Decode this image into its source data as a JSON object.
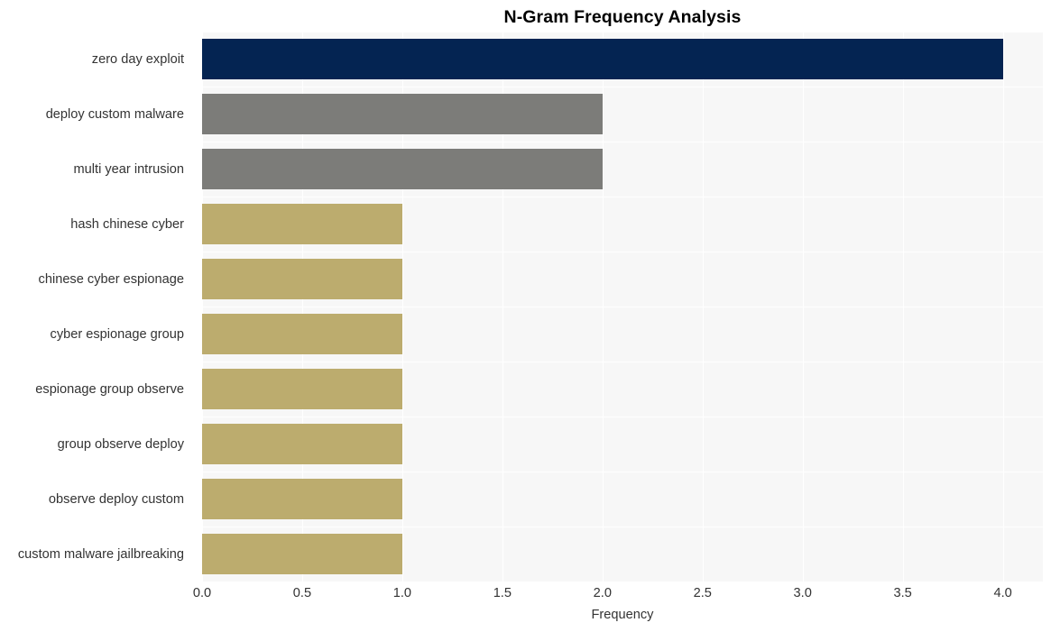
{
  "chart_data": {
    "type": "bar",
    "orientation": "horizontal",
    "title": "N-Gram Frequency Analysis",
    "xlabel": "Frequency",
    "ylabel": "",
    "categories": [
      "zero day exploit",
      "deploy custom malware",
      "multi year intrusion",
      "hash chinese cyber",
      "chinese cyber espionage",
      "cyber espionage group",
      "espionage group observe",
      "group observe deploy",
      "observe deploy custom",
      "custom malware jailbreaking"
    ],
    "values": [
      4,
      2,
      2,
      1,
      1,
      1,
      1,
      1,
      1,
      1
    ],
    "bar_colors": [
      "#042452",
      "#7c7c79",
      "#7c7c79",
      "#bcac6e",
      "#bcac6e",
      "#bcac6e",
      "#bcac6e",
      "#bcac6e",
      "#bcac6e",
      "#bcac6e"
    ],
    "xlim": [
      0.0,
      4.2
    ],
    "xticks": [
      0.0,
      0.5,
      1.0,
      1.5,
      2.0,
      2.5,
      3.0,
      3.5,
      4.0
    ],
    "xtick_labels": [
      "0.0",
      "0.5",
      "1.0",
      "1.5",
      "2.0",
      "2.5",
      "3.0",
      "3.5",
      "4.0"
    ],
    "grid": true,
    "grid_color": "#ffffff",
    "plot_background": "#f7f7f7",
    "figure_background": "#ffffff",
    "legend": null,
    "text_color": "#333333",
    "title_color": "#000000"
  }
}
